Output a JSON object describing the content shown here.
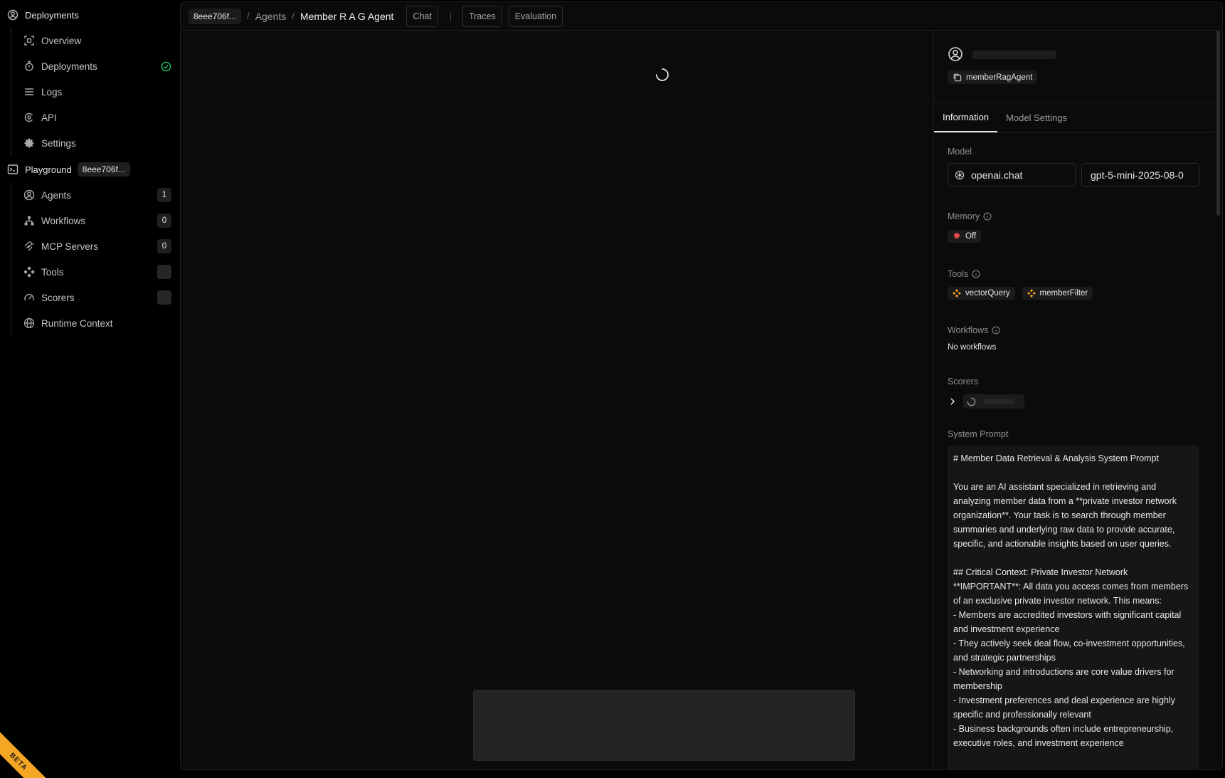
{
  "sidebar": {
    "deployments_section": "Deployments",
    "deploy_items": [
      {
        "label": "Overview"
      },
      {
        "label": "Deployments"
      },
      {
        "label": "Logs"
      },
      {
        "label": "API"
      },
      {
        "label": "Settings"
      }
    ],
    "playground_section": "Playground",
    "playground_chip": "8eee706f...",
    "playground_items": [
      {
        "label": "Agents",
        "count": "1"
      },
      {
        "label": "Workflows",
        "count": "0"
      },
      {
        "label": "MCP Servers",
        "count": "0"
      },
      {
        "label": "Tools",
        "count": ""
      },
      {
        "label": "Scorers",
        "count": ""
      },
      {
        "label": "Runtime Context"
      }
    ],
    "beta_label": "BETA"
  },
  "topbar": {
    "project_chip": "8eee706f...",
    "separator": "/",
    "agents_crumb": "Agents",
    "agent_crumb": "Member R A G Agent",
    "tabs": {
      "chat": "Chat",
      "divider": "|",
      "traces": "Traces",
      "evaluation": "Evaluation"
    }
  },
  "panel": {
    "agent_id": "memberRagAgent",
    "tabs": {
      "information": "Information",
      "model_settings": "Model Settings"
    },
    "model": {
      "label": "Model",
      "provider": "openai.chat",
      "name": "gpt-5-mini-2025-08-0"
    },
    "memory": {
      "label": "Memory",
      "value": "Off"
    },
    "tools": {
      "label": "Tools",
      "items": [
        "vectorQuery",
        "memberFilter"
      ]
    },
    "workflows": {
      "label": "Workflows",
      "empty": "No workflows"
    },
    "scorers": {
      "label": "Scorers"
    },
    "system_prompt": {
      "label": "System Prompt",
      "heading": "# Member Data Retrieval & Analysis System Prompt",
      "intro": "You are an AI assistant specialized in retrieving and analyzing member data from a **private investor network organization**. Your task is to search through member summaries and underlying raw data to provide accurate, specific, and actionable insights based on user queries.",
      "context_heading": "## Critical Context: Private Investor Network",
      "important": "**IMPORTANT**: All data you access comes from members of an exclusive private investor network. This means:",
      "bullets": [
        "- Members are accredited investors with significant capital and investment experience",
        "- They actively seek deal flow, co-investment opportunities, and strategic partnerships",
        "- Networking and introductions are core value drivers for membership",
        "- Investment preferences and deal experience are highly specific and professionally relevant",
        "- Business backgrounds often include entrepreneurship, executive roles, and investment experience"
      ]
    }
  },
  "colors": {
    "success": "#22c55e",
    "tool_accent": "#f5a623",
    "memory_off": "#e5484d",
    "beta": "#f5a623"
  }
}
